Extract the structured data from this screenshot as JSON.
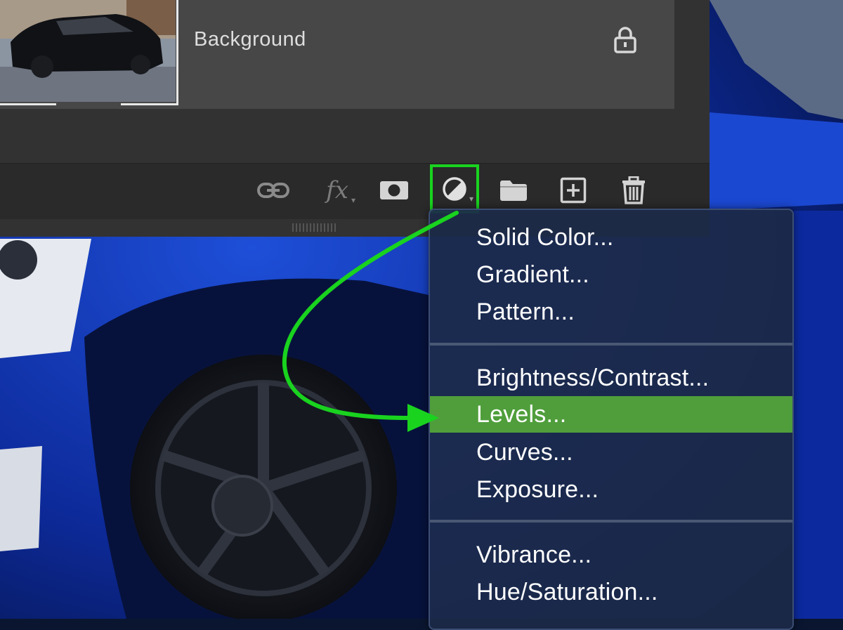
{
  "layer": {
    "name": "Background"
  },
  "footer_icons": {
    "fx": "fx"
  },
  "menu": {
    "items": [
      {
        "label": "Solid Color..."
      },
      {
        "label": "Gradient..."
      },
      {
        "label": "Pattern..."
      },
      {
        "label": "Brightness/Contrast..."
      },
      {
        "label": "Levels..."
      },
      {
        "label": "Curves..."
      },
      {
        "label": "Exposure..."
      },
      {
        "label": "Vibrance..."
      },
      {
        "label": "Hue/Saturation..."
      }
    ],
    "active_item": "Levels..."
  },
  "colors": {
    "highlight_green": "#19d31f",
    "menu_active": "#4f9e3b",
    "menu_bg": "#1c2a48",
    "panel_bg": "#323232"
  },
  "icons": [
    "lock-icon",
    "link-icon",
    "fx-icon",
    "mask-icon",
    "adjustment-layer-icon",
    "folder-icon",
    "new-layer-icon",
    "trash-icon"
  ]
}
